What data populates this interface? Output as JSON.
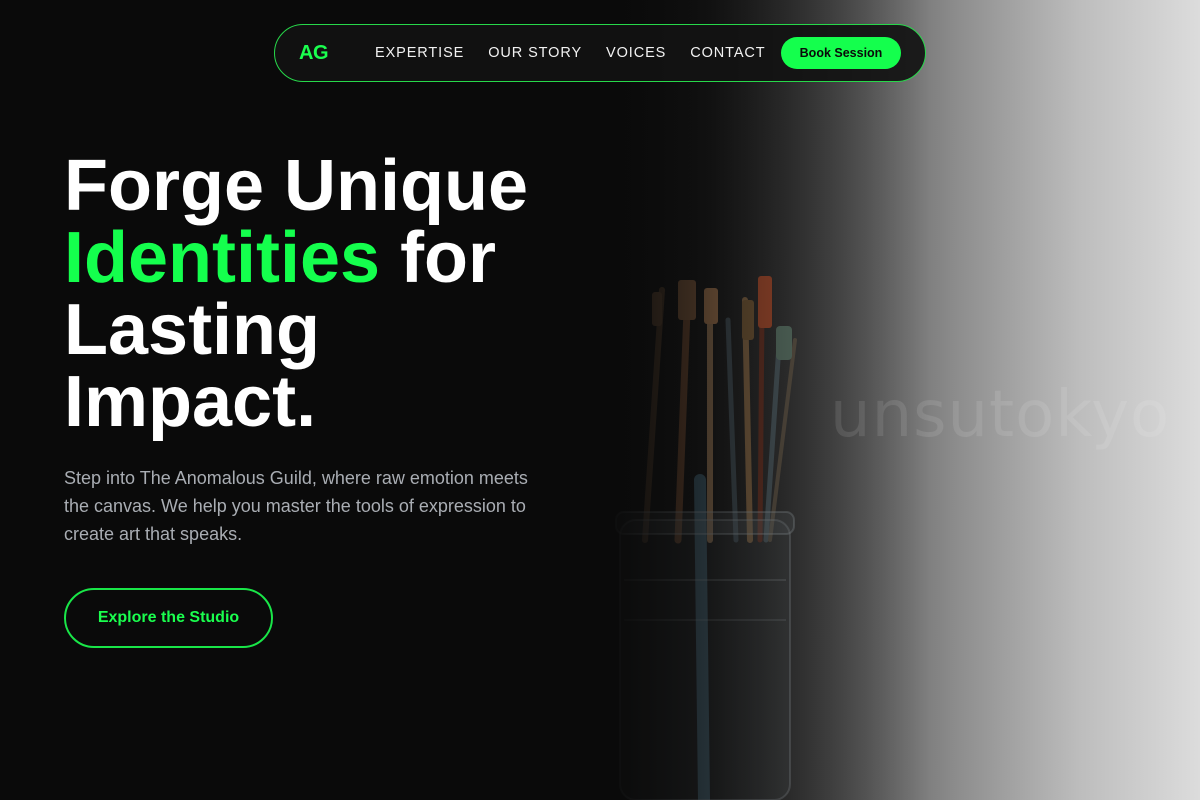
{
  "nav": {
    "logo": "AG",
    "links": [
      "EXPERTISE",
      "OUR STORY",
      "VOICES",
      "CONTACT"
    ],
    "book_label": "Book Session"
  },
  "hero": {
    "headline_part1": "Forge Unique",
    "headline_accent": "Identities",
    "headline_part2": " for",
    "headline_part3": "Lasting",
    "headline_part4": "Impact.",
    "subtitle": "Step into The Anomalous Guild, where raw emotion meets the canvas. We help you master the tools of expression to create art that speaks.",
    "cta_label": "Explore the Studio",
    "image_watermark": "unsutokyo"
  },
  "colors": {
    "accent": "#14ff4d",
    "background": "#0a0a0a",
    "text_muted": "#a9adb3"
  },
  "icons": {
    "hero_image": "paint-brushes-in-jar"
  }
}
